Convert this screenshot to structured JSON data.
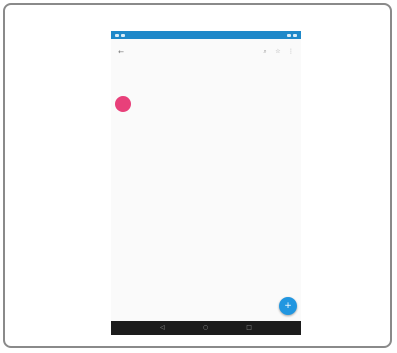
{
  "status_bar": {
    "left_text": "",
    "right_text": ""
  },
  "toolbar": {
    "back_icon": "back-arrow-icon",
    "title": "",
    "actions": [
      "search-icon",
      "star-icon",
      "more-icon"
    ]
  },
  "account_row": {
    "left": "",
    "right": ""
  },
  "section_label": "",
  "contact": {
    "avatar_letter": "",
    "name": ""
  },
  "fab_icon": "add-icon",
  "colors": {
    "status_bar": "#1e88c9",
    "avatar": "#e8407a",
    "fab": "#2196e0",
    "nav_bar": "#1c1c1c"
  }
}
